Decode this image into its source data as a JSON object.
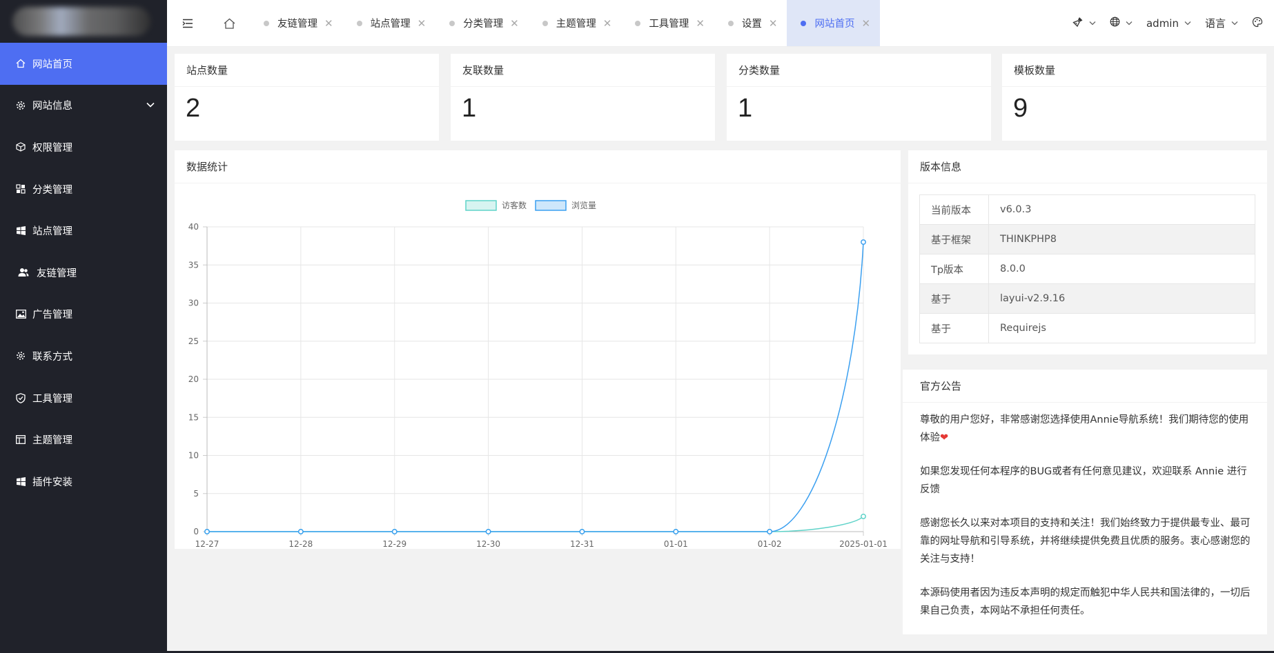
{
  "sidebar": {
    "items": [
      {
        "label": "网站首页",
        "icon": "home-icon",
        "active": true
      },
      {
        "label": "网站信息",
        "icon": "gear-icon",
        "has_caret": true
      },
      {
        "label": "权限管理",
        "icon": "cube-icon"
      },
      {
        "label": "分类管理",
        "icon": "grid-icon"
      },
      {
        "label": "站点管理",
        "icon": "windows-icon"
      },
      {
        "label": "友链管理",
        "icon": "users-icon"
      },
      {
        "label": "广告管理",
        "icon": "image-icon"
      },
      {
        "label": "联系方式",
        "icon": "settings-icon"
      },
      {
        "label": "工具管理",
        "icon": "shield-icon"
      },
      {
        "label": "主题管理",
        "icon": "layout-icon"
      },
      {
        "label": "插件安装",
        "icon": "windows-icon"
      }
    ]
  },
  "header": {
    "tabs": [
      {
        "label": "友链管理"
      },
      {
        "label": "站点管理"
      },
      {
        "label": "分类管理"
      },
      {
        "label": "主题管理"
      },
      {
        "label": "工具管理"
      },
      {
        "label": "设置"
      },
      {
        "label": "网站首页",
        "active": true
      }
    ],
    "user": "admin",
    "language": "语言"
  },
  "stats": [
    {
      "title": "站点数量",
      "value": "2"
    },
    {
      "title": "友联数量",
      "value": "1"
    },
    {
      "title": "分类数量",
      "value": "1"
    },
    {
      "title": "模板数量",
      "value": "9"
    }
  ],
  "chart_panel": {
    "title": "数据统计"
  },
  "chart_data": {
    "type": "line",
    "categories": [
      "12-27",
      "12-28",
      "12-29",
      "12-30",
      "12-31",
      "01-01",
      "01-02",
      "2025-01-01"
    ],
    "series": [
      {
        "name": "访客数",
        "values": [
          0,
          0,
          0,
          0,
          0,
          0,
          0,
          2
        ],
        "color": "#5fd3c9"
      },
      {
        "name": "浏览量",
        "values": [
          0,
          0,
          0,
          0,
          0,
          0,
          0,
          38
        ],
        "color": "#3a9ff0"
      }
    ],
    "ylim": [
      0,
      40
    ],
    "yticks": [
      0,
      5,
      10,
      15,
      20,
      25,
      30,
      35,
      40
    ],
    "legend": "top-center",
    "grid": true
  },
  "version_panel": {
    "title": "版本信息",
    "rows": [
      {
        "key": "当前版本",
        "value": "v6.0.3"
      },
      {
        "key": "基于框架",
        "value": "THINKPHP8"
      },
      {
        "key": "Tp版本",
        "value": "8.0.0"
      },
      {
        "key": "基于",
        "value": "layui-v2.9.16"
      },
      {
        "key": "基于",
        "value": "Requirejs"
      }
    ]
  },
  "notice_panel": {
    "title": "官方公告",
    "paragraphs": [
      "尊敬的用户您好，非常感谢您选择使用Annie导航系统！我们期待您的使用体验",
      "如果您发现任何本程序的BUG或者有任何意见建议，欢迎联系 Annie 进行反馈",
      "感谢您长久以来对本项目的支持和关注！我们始终致力于提供最专业、最可靠的网址导航和引导系统，并将继续提供免费且优质的服务。衷心感谢您的关注与支持！",
      "本源码使用者因为违反本声明的规定而触犯中华人民共和国法律的，一切后果自己负责，本网站不承担任何责任。"
    ],
    "heart": "❤"
  }
}
